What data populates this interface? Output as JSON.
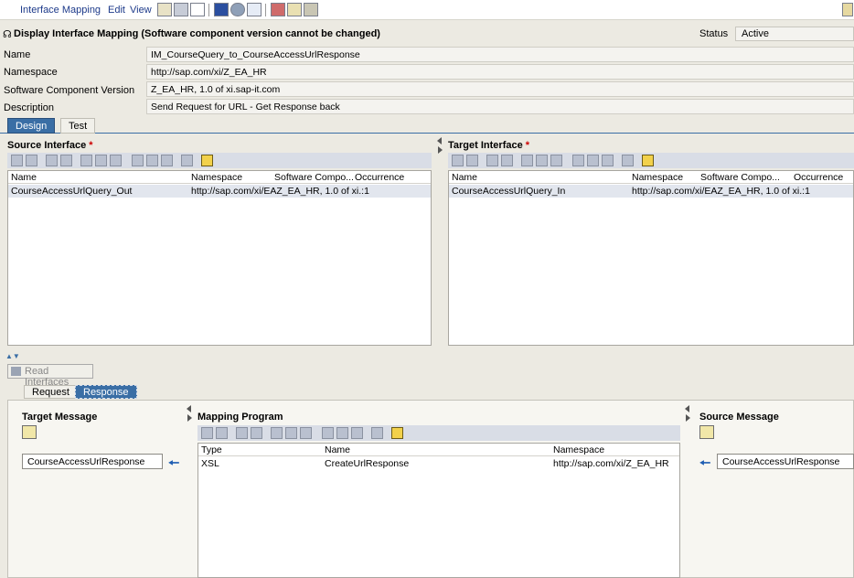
{
  "menu": {
    "interface_mapping": "Interface Mapping",
    "edit": "Edit",
    "view": "View"
  },
  "header": {
    "title": "Display Interface Mapping (Software component version cannot be changed)",
    "status_label": "Status",
    "status_value": "Active"
  },
  "form": {
    "name_label": "Name",
    "name_value": "IM_CourseQuery_to_CourseAccessUrlResponse",
    "namespace_label": "Namespace",
    "namespace_value": "http://sap.com/xi/Z_EA_HR",
    "swcv_label": "Software Component Version",
    "swcv_value": "Z_EA_HR, 1.0 of xi.sap-it.com",
    "description_label": "Description",
    "description_value": "Send Request for URL - Get Response back"
  },
  "tabs": {
    "design": "Design",
    "test": "Test"
  },
  "source_interface": {
    "title": "Source Interface",
    "required": "*",
    "columns": [
      "Name",
      "Namespace",
      "Software Compo...",
      "Occurrence"
    ],
    "row": {
      "name": "CourseAccessUrlQuery_Out",
      "namespace": "http://sap.com/xi/EAZ_EA_HR, 1.0 of xi.:1"
    }
  },
  "target_interface": {
    "title": "Target Interface",
    "required": "*",
    "columns": [
      "Name",
      "Namespace",
      "Software Compo...",
      "Occurrence"
    ],
    "row": {
      "name": "CourseAccessUrlQuery_In",
      "namespace": "http://sap.com/xi/EAZ_EA_HR, 1.0 of xi.:1"
    }
  },
  "read_interfaces": "Read Interfaces",
  "sub_tabs": {
    "request": "Request",
    "response": "Response"
  },
  "target_message": {
    "title": "Target Message",
    "value": "CourseAccessUrlResponse"
  },
  "mapping_program": {
    "title": "Mapping Program",
    "columns": [
      "Type",
      "Name",
      "Namespace"
    ],
    "row": {
      "type": "XSL",
      "name": "CreateUrlResponse",
      "namespace": "http://sap.com/xi/Z_EA_HR"
    }
  },
  "source_message": {
    "title": "Source Message",
    "value": "CourseAccessUrlResponse"
  },
  "icons": [
    "pencil-icon",
    "save-icon",
    "copy-icon",
    "info-icon",
    "check-icon",
    "tree-icon",
    "print-icon",
    "display-icon",
    "export-icon",
    "headset-icon",
    "left-arrow-icon"
  ]
}
